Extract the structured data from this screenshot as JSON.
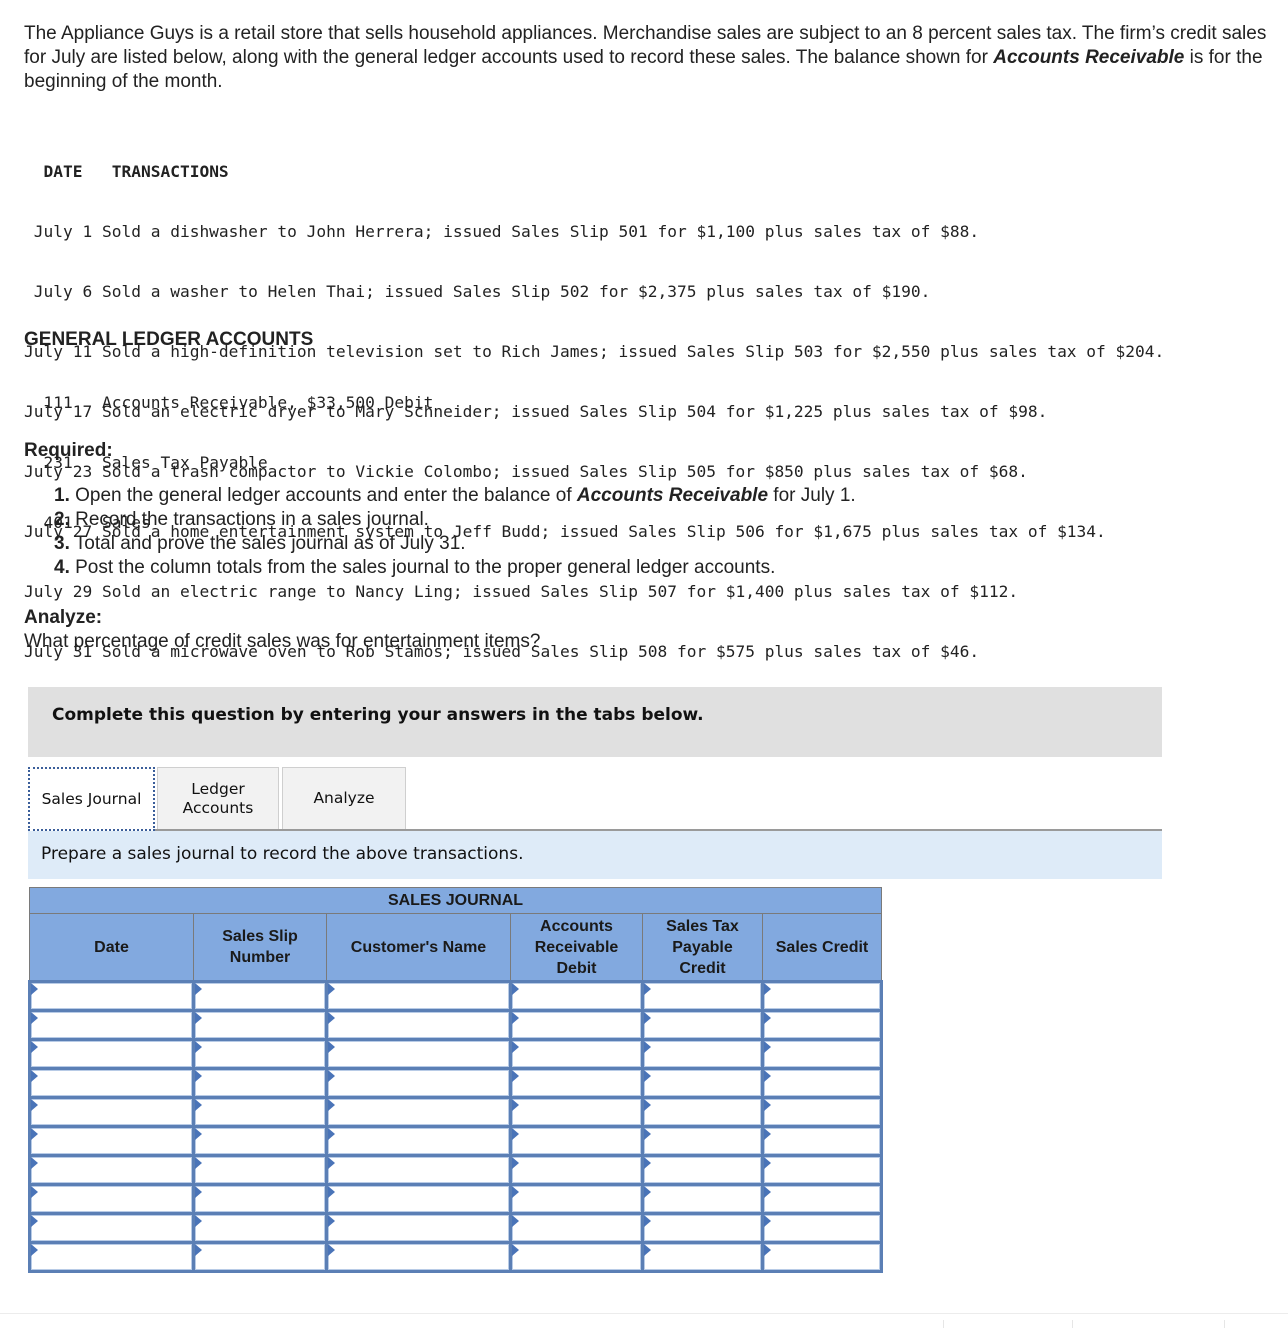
{
  "intro": {
    "text_before": "The Appliance Guys is a retail store that sells household appliances. Merchandise sales are subject to an 8 percent sales tax. The firm’s credit sales for July are listed below, along with the general ledger accounts used to record these sales. The balance shown for ",
    "emphasis": "Accounts Receivable",
    "text_after": " is for the beginning of the month."
  },
  "transactions": {
    "header_date": "DATE",
    "header_transactions": "TRANSACTIONS",
    "rows": [
      {
        "date": " July 1",
        "text": "Sold a dishwasher to John Herrera; issued Sales Slip 501 for $1,100 plus sales tax of $88."
      },
      {
        "date": " July 6",
        "text": "Sold a washer to Helen Thai; issued Sales Slip 502 for $2,375 plus sales tax of $190."
      },
      {
        "date": "July 11",
        "text": "Sold a high-definition television set to Rich James; issued Sales Slip 503 for $2,550 plus sales tax of $204."
      },
      {
        "date": "July 17",
        "text": "Sold an electric dryer to Mary Schneider; issued Sales Slip 504 for $1,225 plus sales tax of $98."
      },
      {
        "date": "July 23",
        "text": "Sold a trash compactor to Vickie Colombo; issued Sales Slip 505 for $850 plus sales tax of $68."
      },
      {
        "date": "July 27",
        "text": "Sold a home entertainment system to Jeff Budd; issued Sales Slip 506 for $1,675 plus sales tax of $134."
      },
      {
        "date": "July 29",
        "text": "Sold an electric range to Nancy Ling; issued Sales Slip 507 for $1,400 plus sales tax of $112."
      },
      {
        "date": "July 31",
        "text": "Sold a microwave oven to Rob Stamos; issued Sales Slip 508 for $575 plus sales tax of $46."
      }
    ]
  },
  "general_ledger": {
    "title": "GENERAL LEDGER ACCOUNTS",
    "accounts": [
      {
        "number": "111",
        "name": "Accounts Receivable, $33,500 Debit"
      },
      {
        "number": "231",
        "name": "Sales Tax Payable"
      },
      {
        "number": "401",
        "name": "Sales"
      }
    ]
  },
  "required": {
    "title": "Required:",
    "items": [
      {
        "num": "1.",
        "before": " Open the general ledger accounts and enter the balance of ",
        "emphasis": "Accounts Receivable",
        "after": " for July 1."
      },
      {
        "num": "2.",
        "before": " Record the transactions in a sales journal.",
        "emphasis": "",
        "after": ""
      },
      {
        "num": "3.",
        "before": " Total and prove the sales journal as of July 31.",
        "emphasis": "",
        "after": ""
      },
      {
        "num": "4.",
        "before": " Post the column totals from the sales journal to the proper general ledger accounts.",
        "emphasis": "",
        "after": ""
      }
    ]
  },
  "analyze": {
    "title": "Analyze:",
    "question": "What percentage of credit sales was for entertainment items?"
  },
  "instruction": "Complete this question by entering your answers in the tabs below.",
  "tabs": [
    {
      "label": "Sales Journal",
      "active": true
    },
    {
      "label": "Ledger Accounts",
      "active": false
    },
    {
      "label": "Analyze",
      "active": false
    }
  ],
  "panel_message": "Prepare a sales journal to record the above transactions.",
  "sales_journal": {
    "title": "SALES JOURNAL",
    "columns": [
      "Date",
      "Sales Slip Number",
      "Customer's Name",
      "Accounts Receivable Debit",
      "Sales Tax Payable Credit",
      "Sales Credit"
    ],
    "rows": [
      [
        "",
        "",
        "",
        "",
        "",
        ""
      ],
      [
        "",
        "",
        "",
        "",
        "",
        ""
      ],
      [
        "",
        "",
        "",
        "",
        "",
        ""
      ],
      [
        "",
        "",
        "",
        "",
        "",
        ""
      ],
      [
        "",
        "",
        "",
        "",
        "",
        ""
      ],
      [
        "",
        "",
        "",
        "",
        "",
        ""
      ],
      [
        "",
        "",
        "",
        "",
        "",
        ""
      ],
      [
        "",
        "",
        "",
        "",
        "",
        ""
      ],
      [
        "",
        "",
        "",
        "",
        "",
        ""
      ],
      [
        "",
        "",
        "",
        "",
        "",
        ""
      ]
    ]
  }
}
